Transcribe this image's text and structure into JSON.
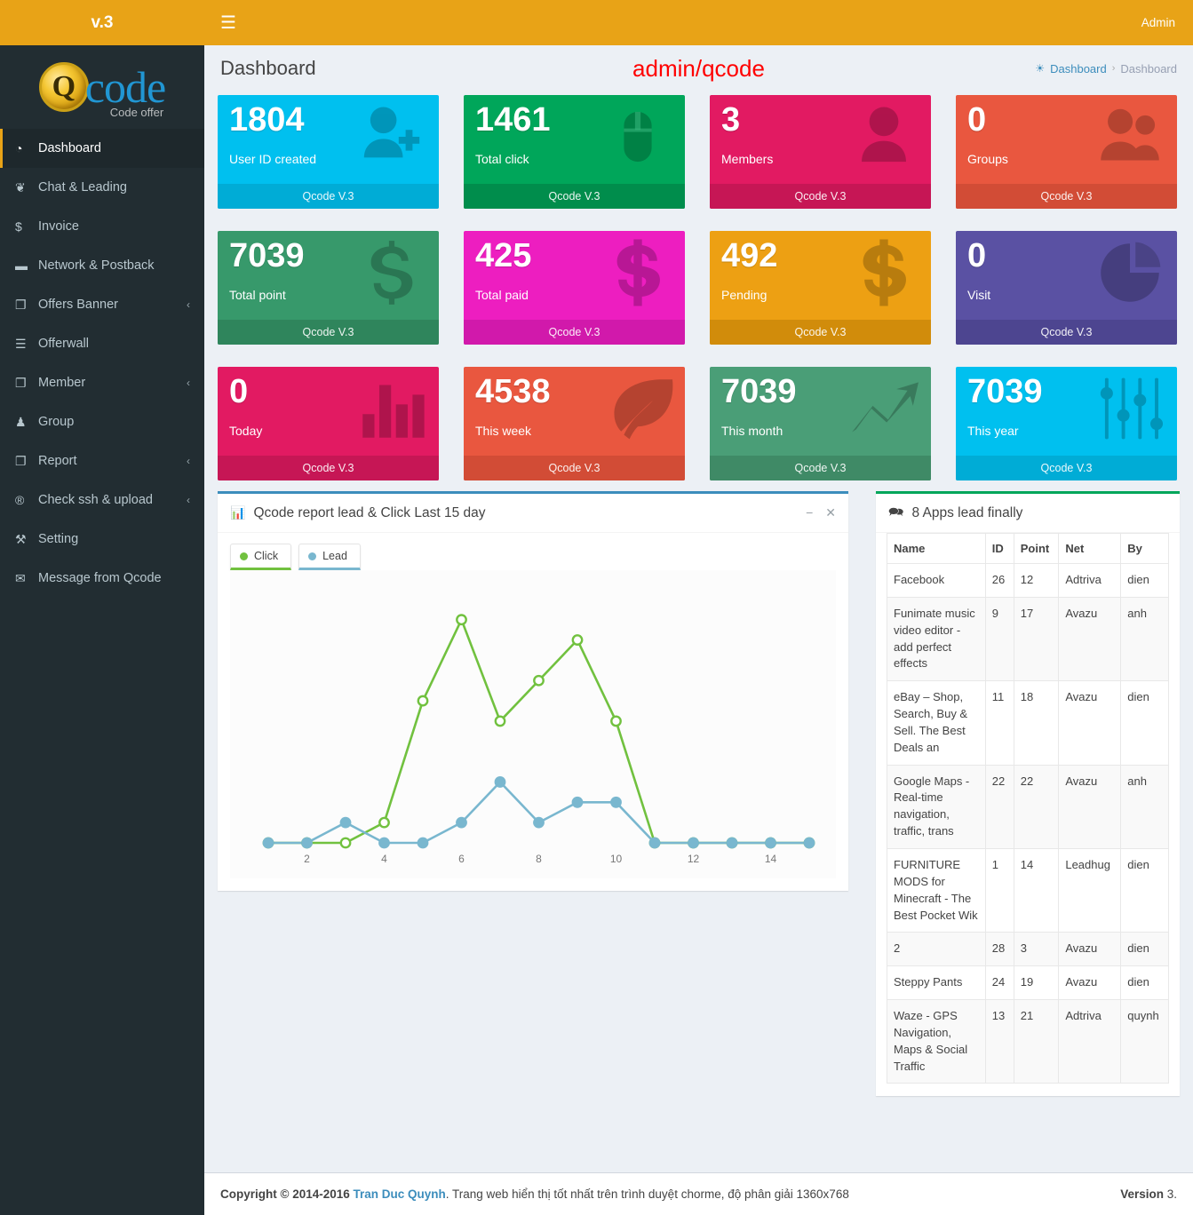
{
  "sidebar": {
    "version_label": "v.3",
    "logo": {
      "coin_letter": "Q",
      "brand": "code",
      "tagline": "Code offer"
    },
    "items": [
      {
        "label": "Dashboard",
        "icon": "dashboard-icon",
        "glyph": "◔",
        "active": true,
        "arrow": ""
      },
      {
        "label": "Chat & Leading",
        "icon": "chat-icon",
        "glyph": "❦",
        "active": false,
        "arrow": ""
      },
      {
        "label": "Invoice",
        "icon": "dollar-icon",
        "glyph": "$",
        "active": false,
        "arrow": ""
      },
      {
        "label": "Network & Postback",
        "icon": "briefcase-icon",
        "glyph": "▬",
        "active": false,
        "arrow": ""
      },
      {
        "label": "Offers Banner",
        "icon": "copy-icon",
        "glyph": "❐",
        "active": false,
        "arrow": "‹"
      },
      {
        "label": "Offerwall",
        "icon": "list-icon",
        "glyph": "☰",
        "active": false,
        "arrow": ""
      },
      {
        "label": "Member",
        "icon": "copy-icon",
        "glyph": "❐",
        "active": false,
        "arrow": "‹"
      },
      {
        "label": "Group",
        "icon": "group-icon",
        "glyph": "♟",
        "active": false,
        "arrow": ""
      },
      {
        "label": "Report",
        "icon": "copy-icon",
        "glyph": "❐",
        "active": false,
        "arrow": "‹"
      },
      {
        "label": "Check ssh & upload",
        "icon": "registered-icon",
        "glyph": "®",
        "active": false,
        "arrow": "‹"
      },
      {
        "label": "Setting",
        "icon": "wrench-icon",
        "glyph": "⚒",
        "active": false,
        "arrow": ""
      },
      {
        "label": "Message from Qcode",
        "icon": "envelope-icon",
        "glyph": "✉",
        "active": false,
        "arrow": ""
      }
    ]
  },
  "topbar": {
    "menu_toggle": "☰",
    "admin_label": "Admin"
  },
  "content_header": {
    "page_title": "Dashboard",
    "overlay_title": "admin/qcode",
    "breadcrumb": {
      "icon": "dashboard-icon",
      "root": "Dashboard",
      "separator": "›",
      "current": "Dashboard"
    }
  },
  "cards": [
    {
      "value": "1804",
      "label": "User ID created",
      "footer": "Qcode V.3",
      "color": "#00c0ef",
      "footer_color": "#00acd6",
      "icon": "user-plus-icon"
    },
    {
      "value": "1461",
      "label": "Total click",
      "footer": "Qcode V.3",
      "color": "#00a65a",
      "footer_color": "#008d4c",
      "icon": "mouse-icon"
    },
    {
      "value": "3",
      "label": "Members",
      "footer": "Qcode V.3",
      "color": "#e21a62",
      "footer_color": "#c61655",
      "icon": "user-icon"
    },
    {
      "value": "0",
      "label": "Groups",
      "footer": "Qcode V.3",
      "color": "#e9573f",
      "footer_color": "#d24c36",
      "icon": "users-icon"
    },
    {
      "value": "7039",
      "label": "Total point",
      "footer": "Qcode V.3",
      "color": "#37996b",
      "footer_color": "#2f855c",
      "icon": "dollar-outline-icon"
    },
    {
      "value": "425",
      "label": "Total paid",
      "footer": "Qcode V.3",
      "color": "#ed1ec0",
      "footer_color": "#d119ab",
      "icon": "dollar-solid-icon"
    },
    {
      "value": "492",
      "label": "Pending",
      "footer": "Qcode V.3",
      "color": "#eda013",
      "footer_color": "#d18c0b",
      "icon": "dollar-solid-icon"
    },
    {
      "value": "0",
      "label": "Visit",
      "footer": "Qcode V.3",
      "color": "#5a51a3",
      "footer_color": "#4d4590",
      "icon": "pie-chart-icon"
    },
    {
      "value": "0",
      "label": "Today",
      "footer": "Qcode V.3",
      "color": "#e21a62",
      "footer_color": "#c61655",
      "icon": "bar-chart-icon"
    },
    {
      "value": "4538",
      "label": "This week",
      "footer": "Qcode V.3",
      "color": "#e9573f",
      "footer_color": "#d24c36",
      "icon": "leaf-icon"
    },
    {
      "value": "7039",
      "label": "This month",
      "footer": "Qcode V.3",
      "color": "#4a9e77",
      "footer_color": "#3f8a66",
      "icon": "trend-up-icon"
    },
    {
      "value": "7039",
      "label": "This year",
      "footer": "Qcode V.3",
      "color": "#00c0ef",
      "footer_color": "#00acd6",
      "icon": "sliders-icon"
    }
  ],
  "chart_panel": {
    "icon": "bar-chart-icon",
    "title": "Qcode report lead & Click Last 15 day",
    "minimize": "−",
    "close": "✕",
    "legend": [
      {
        "label": "Click",
        "color": "#71c13f"
      },
      {
        "label": "Lead",
        "color": "#79b7cf"
      }
    ]
  },
  "chart_data": {
    "type": "line",
    "title": "Qcode report lead & Click Last 15 day",
    "xlabel": "",
    "ylabel": "",
    "x": [
      1,
      2,
      3,
      4,
      5,
      6,
      7,
      8,
      9,
      10,
      11,
      12,
      13,
      14,
      15
    ],
    "xticks": [
      2,
      4,
      6,
      8,
      10,
      12,
      14
    ],
    "xlim": [
      1,
      15
    ],
    "ylim": [
      0,
      13
    ],
    "grid": false,
    "legend_position": "top-left",
    "series": [
      {
        "name": "Click",
        "color": "#71c13f",
        "marker": "hollow-circle",
        "values": [
          0,
          0,
          0,
          1,
          7,
          11,
          6,
          8,
          10,
          6,
          0,
          0,
          0,
          0,
          0
        ]
      },
      {
        "name": "Lead",
        "color": "#79b7cf",
        "marker": "filled-circle",
        "values": [
          0,
          0,
          1,
          0,
          0,
          1,
          3,
          1,
          2,
          2,
          0,
          0,
          0,
          0,
          0
        ]
      }
    ]
  },
  "apps_panel": {
    "icon": "comments-icon",
    "title": "8 Apps lead finally",
    "columns": [
      "Name",
      "ID",
      "Point",
      "Net",
      "By"
    ],
    "rows": [
      {
        "name": "Facebook",
        "id": "26",
        "point": "12",
        "net": "Adtriva",
        "by": "dien"
      },
      {
        "name": "Funimate music video editor - add perfect effects",
        "id": "9",
        "point": "17",
        "net": "Avazu",
        "by": "anh"
      },
      {
        "name": "eBay – Shop, Search, Buy & Sell. The Best Deals an",
        "id": "11",
        "point": "18",
        "net": "Avazu",
        "by": "dien"
      },
      {
        "name": "Google Maps - Real-time navigation, traffic, trans",
        "id": "22",
        "point": "22",
        "net": "Avazu",
        "by": "anh"
      },
      {
        "name": "FURNITURE MODS for Minecraft - The Best Pocket Wik",
        "id": "1",
        "point": "14",
        "net": "Leadhug",
        "by": "dien"
      },
      {
        "name": "2",
        "id": "28",
        "point": "3",
        "net": "Avazu",
        "by": "dien"
      },
      {
        "name": "Steppy Pants",
        "id": "24",
        "point": "19",
        "net": "Avazu",
        "by": "dien"
      },
      {
        "name": "Waze - GPS Navigation, Maps & Social Traffic",
        "id": "13",
        "point": "21",
        "net": "Adtriva",
        "by": "quynh"
      }
    ]
  },
  "footer": {
    "copyright": "Copyright © 2014-2016 ",
    "author": "Tran Duc Quynh",
    "tail": ". Trang web hiển thị tốt nhất trên trình duyệt chorme, độ phân giải 1360x768",
    "version_label": "Version",
    "version_value": " 3."
  }
}
